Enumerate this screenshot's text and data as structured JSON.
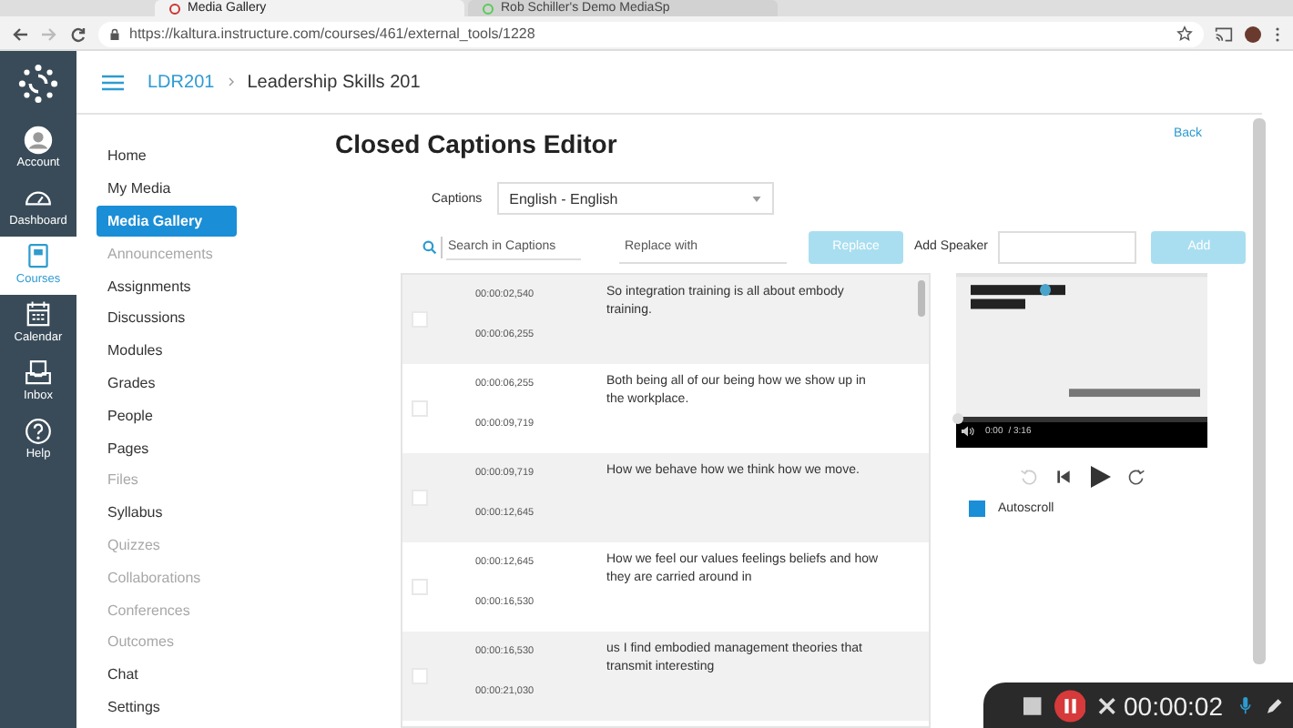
{
  "browser": {
    "tabs": [
      {
        "label": "Media Gallery",
        "selected": true
      },
      {
        "label": "Rob Schiller's Demo MediaSp",
        "selected": false
      }
    ],
    "url": "https://kaltura.instructure.com/courses/461/external_tools/1228"
  },
  "global_nav": [
    {
      "label": "Account",
      "kind": "avatar",
      "selected": false
    },
    {
      "label": "Dashboard",
      "kind": "gauge",
      "selected": false
    },
    {
      "label": "Courses",
      "kind": "book",
      "selected": true
    },
    {
      "label": "Calendar",
      "kind": "calendar",
      "selected": false
    },
    {
      "label": "Inbox",
      "kind": "inbox",
      "selected": false
    },
    {
      "label": "Help",
      "kind": "help",
      "selected": false
    }
  ],
  "breadcrumb": {
    "course": "LDR201",
    "page": "Leadership Skills 201"
  },
  "course_nav": [
    {
      "label": "Home",
      "selected": false,
      "disabled": false
    },
    {
      "label": "My Media",
      "selected": false,
      "disabled": false
    },
    {
      "label": "Media Gallery",
      "selected": true,
      "disabled": false
    },
    {
      "label": "Announcements",
      "selected": false,
      "disabled": true
    },
    {
      "label": "Assignments",
      "selected": false,
      "disabled": false
    },
    {
      "label": "Discussions",
      "selected": false,
      "disabled": false
    },
    {
      "label": "Modules",
      "selected": false,
      "disabled": false
    },
    {
      "label": "Grades",
      "selected": false,
      "disabled": false
    },
    {
      "label": "People",
      "selected": false,
      "disabled": false
    },
    {
      "label": "Pages",
      "selected": false,
      "disabled": false
    },
    {
      "label": "Files",
      "selected": false,
      "disabled": true
    },
    {
      "label": "Syllabus",
      "selected": false,
      "disabled": false
    },
    {
      "label": "Quizzes",
      "selected": false,
      "disabled": true
    },
    {
      "label": "Collaborations",
      "selected": false,
      "disabled": true
    },
    {
      "label": "Conferences",
      "selected": false,
      "disabled": true
    },
    {
      "label": "Outcomes",
      "selected": false,
      "disabled": true
    },
    {
      "label": "Chat",
      "selected": false,
      "disabled": false
    },
    {
      "label": "Settings",
      "selected": false,
      "disabled": false
    }
  ],
  "editor": {
    "title": "Closed Captions Editor",
    "back": "Back",
    "captions_label": "Captions",
    "captions_value": "English - English",
    "search": {
      "placeholder": "Search in Captions"
    },
    "replace": {
      "placeholder": "Replace with"
    },
    "replace_button": "Replace",
    "add_speaker_label": "Add Speaker",
    "add_button": "Add",
    "rows": [
      {
        "start": "00:00:02,540",
        "end": "00:00:06,255",
        "text": "So integration training is all about embody training.",
        "checked": false
      },
      {
        "start": "00:00:06,255",
        "end": "00:00:09,719",
        "text": "Both being all of our being how we show up in the workplace.",
        "checked": false
      },
      {
        "start": "00:00:09,719",
        "end": "00:00:12,645",
        "text": "How we behave how we think how we move.",
        "checked": false
      },
      {
        "start": "00:00:12,645",
        "end": "00:00:16,530",
        "text": "How we feel our values feelings beliefs and how they are carried around in",
        "checked": false
      },
      {
        "start": "00:00:16,530",
        "end": "00:00:21,030",
        "text": "us I find embodied management theories that transmit interesting",
        "checked": false
      }
    ],
    "player": {
      "current": "0:00",
      "duration": "/ 3:16"
    },
    "autoscroll": {
      "label": "Autoscroll",
      "checked": true
    }
  },
  "recorder": {
    "time": "00:00:02"
  }
}
